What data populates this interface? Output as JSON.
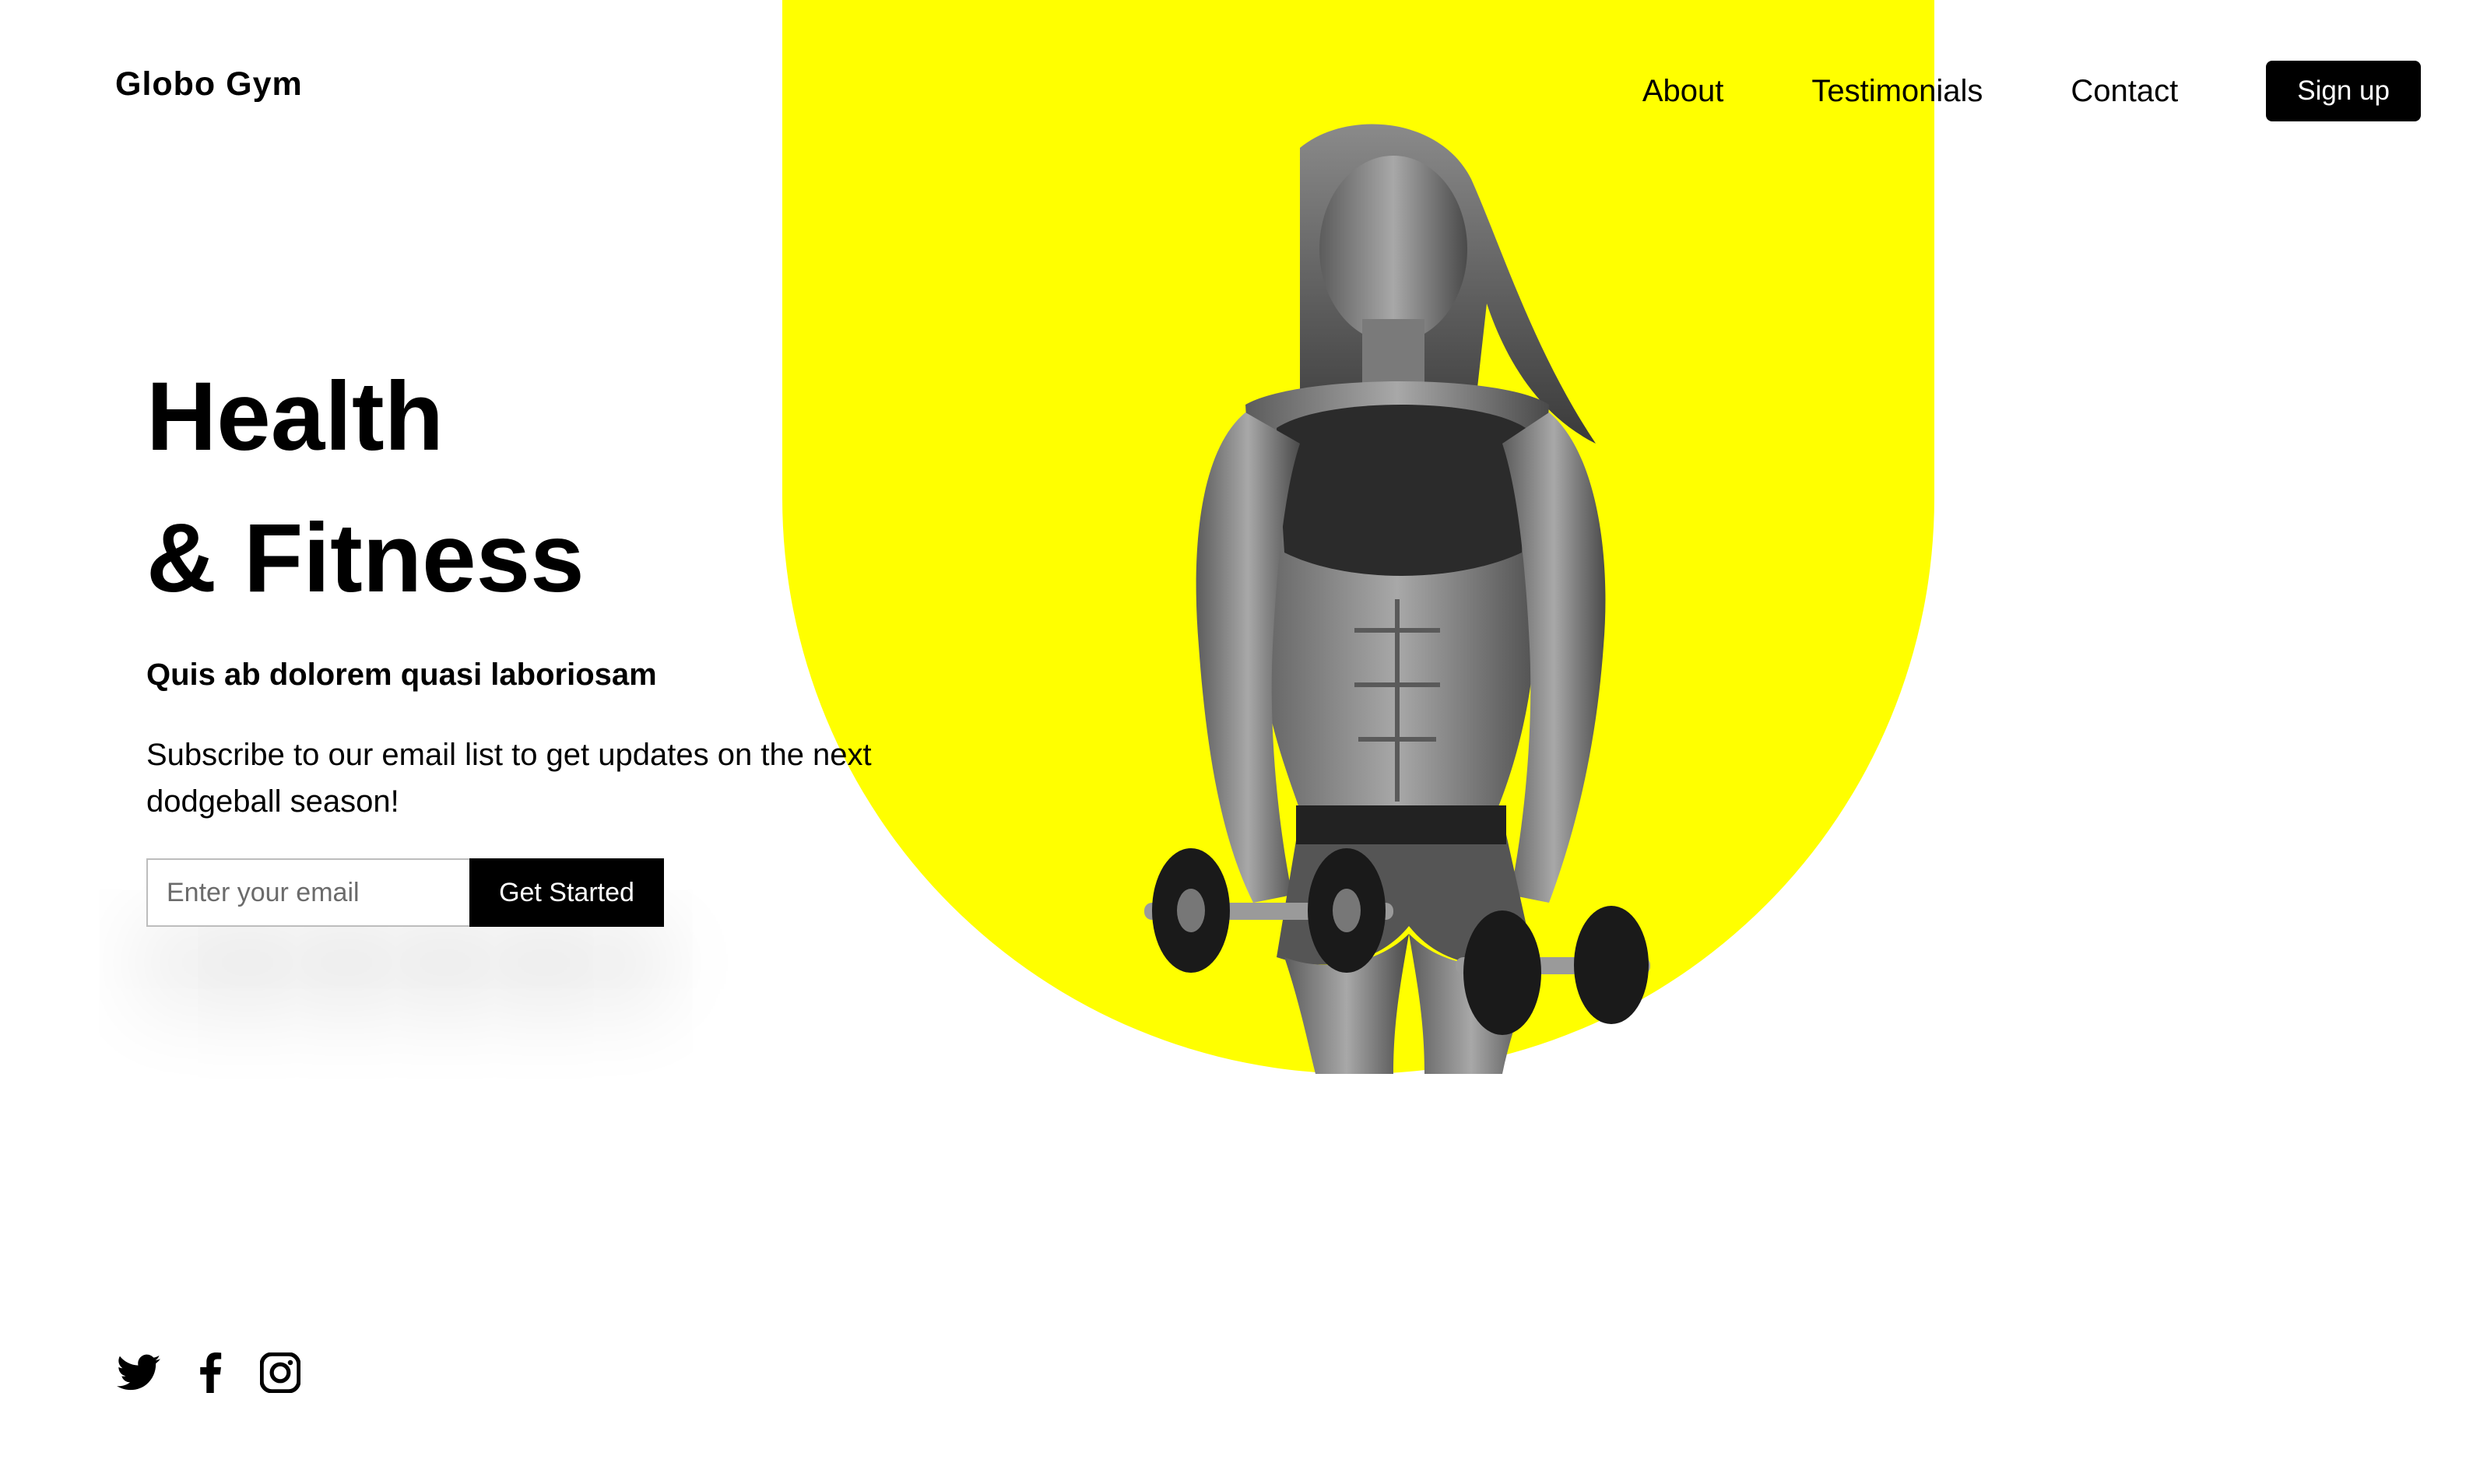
{
  "brand": {
    "name": "Globo Gym",
    "accent_color": "#FFFF00"
  },
  "nav": {
    "items": [
      {
        "label": "About"
      },
      {
        "label": "Testimonials"
      },
      {
        "label": "Contact"
      }
    ],
    "signup_label": "Sign up"
  },
  "hero": {
    "title_line1": "Health",
    "title_line2": "& Fitness",
    "subtitle": "Quis ab dolorem quasi laboriosam",
    "description": "Subscribe to our email list to get updates on the next dodgeball season!",
    "email_placeholder": "Enter your email",
    "cta_label": "Get Started",
    "image_icon": "woman-with-dumbbells-photo"
  },
  "social": {
    "icons": [
      "twitter-icon",
      "facebook-icon",
      "instagram-icon"
    ]
  }
}
